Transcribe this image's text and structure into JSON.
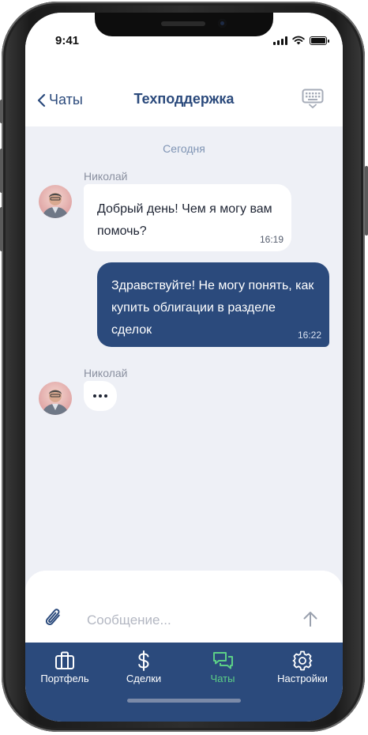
{
  "status_bar": {
    "time": "9:41"
  },
  "header": {
    "back_label": "Чаты",
    "title": "Техподдержка"
  },
  "chat": {
    "date_label": "Сегодня",
    "messages": [
      {
        "author": "Николай",
        "text": "Добрый день! Чем я могу вам помочь?",
        "time": "16:19",
        "direction": "incoming"
      },
      {
        "text": "Здравствуйте! Не могу понять, как купить облигации в разделе сделок",
        "time": "16:22",
        "direction": "outgoing"
      }
    ],
    "typing": {
      "author": "Николай",
      "indicator": "•••"
    }
  },
  "composer": {
    "placeholder": "Сообщение...",
    "value": ""
  },
  "tabbar": {
    "items": [
      {
        "label": "Портфель",
        "icon": "briefcase-icon"
      },
      {
        "label": "Сделки",
        "icon": "dollar-icon"
      },
      {
        "label": "Чаты",
        "icon": "chat-icon",
        "active": true
      },
      {
        "label": "Настройки",
        "icon": "gear-icon"
      }
    ]
  },
  "colors": {
    "brand": "#2b4a7c",
    "active_tab": "#5ccf86",
    "chat_background": "#eef0f6",
    "incoming_bubble": "#ffffff",
    "outgoing_bubble": "#2b4a7c"
  }
}
